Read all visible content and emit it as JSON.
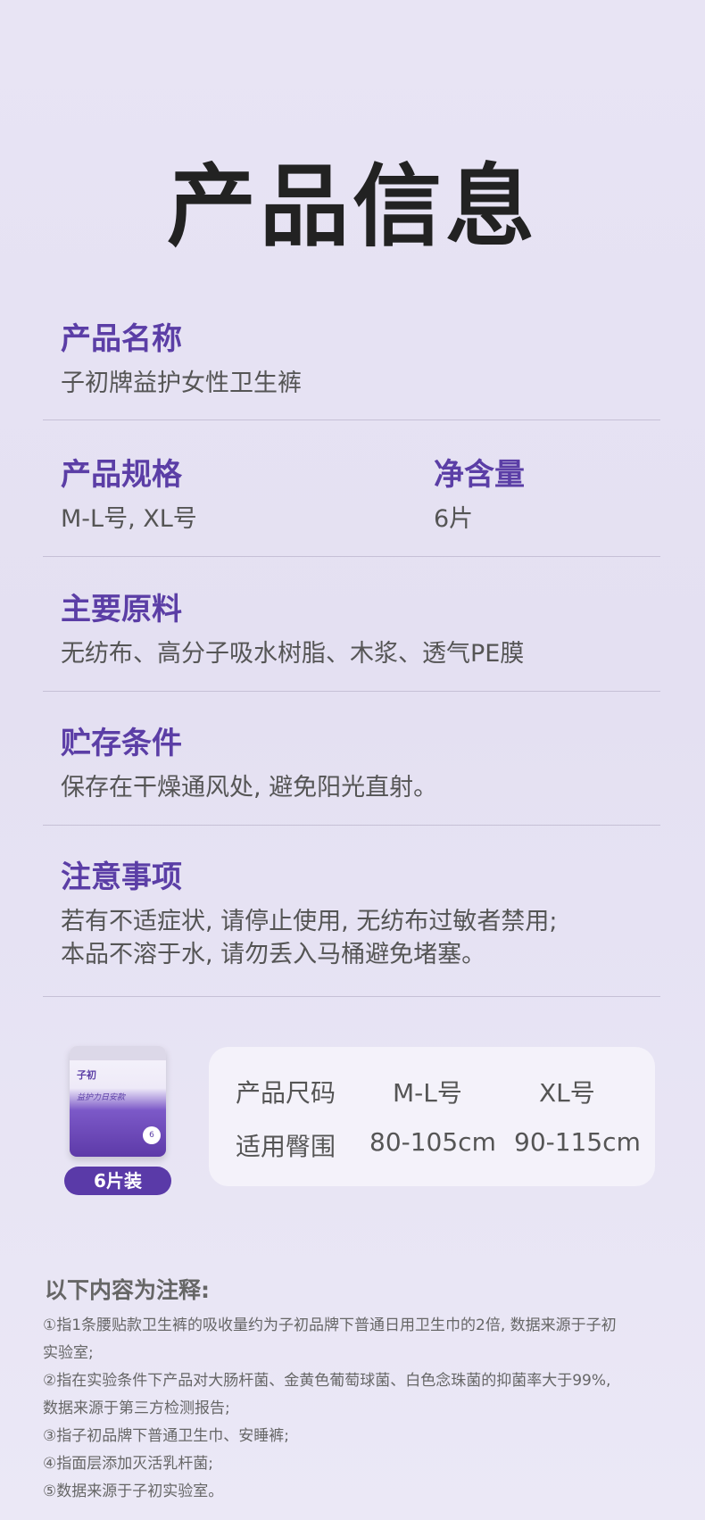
{
  "title": "产品信息",
  "product_name": {
    "label": "产品名称",
    "value": "子初牌益护女性卫生裤"
  },
  "spec": {
    "label": "产品规格",
    "value": "M-L号, XL号"
  },
  "net_content": {
    "label": "净含量",
    "value": "6片"
  },
  "materials": {
    "label": "主要原料",
    "value": "无纺布、高分子吸水树脂、木浆、透气PE膜"
  },
  "storage": {
    "label": "贮存条件",
    "value": "保存在干燥通风处, 避免阳光直射。"
  },
  "notice": {
    "label": "注意事项",
    "line1": "若有不适症状, 请停止使用, 无纺布过敏者禁用;",
    "line2": "本品不溶于水, 请勿丢入马桶避免堵塞。"
  },
  "package": {
    "badge": "6片装",
    "brand": "子初",
    "name": "益护力日安款",
    "count": "6"
  },
  "size_table": {
    "row1": {
      "label": "产品尺码",
      "ml": "M-L号",
      "xl": "XL号"
    },
    "row2": {
      "label": "适用臀围",
      "ml": "80-105cm",
      "xl": "90-115cm"
    }
  },
  "notes": {
    "title": "以下内容为注释:",
    "items": [
      "①指1条腰贴款卫生裤的吸收量约为子初品牌下普通日用卫生巾的2倍, 数据来源于子初",
      "实验室;",
      "②指在实验条件下产品对大肠杆菌、金黄色葡萄球菌、白色念珠菌的抑菌率大于99%,",
      "数据来源于第三方检测报告;",
      "③指子初品牌下普通卫生巾、安睡裤;",
      "④指面层添加灭活乳杆菌;",
      "⑤数据来源于子初实验室。"
    ]
  },
  "colors": {
    "accent": "#5b3ea6",
    "background": "#e6e2f3"
  }
}
